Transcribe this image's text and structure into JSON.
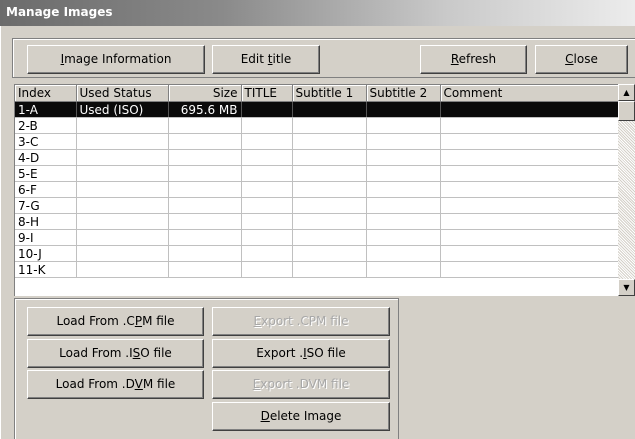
{
  "window": {
    "title": "Manage Images"
  },
  "toolbar": {
    "image_info": {
      "pre": "",
      "u": "I",
      "post": "mage Information"
    },
    "edit_title": {
      "pre": "Edit ",
      "u": "t",
      "post": "itle"
    },
    "refresh": {
      "pre": "",
      "u": "R",
      "post": "efresh"
    },
    "close": {
      "pre": "",
      "u": "C",
      "post": "lose"
    }
  },
  "table": {
    "columns": [
      "Index",
      "Used Status",
      "Size",
      "TITLE",
      "Subtitle 1",
      "Subtitle 2",
      "Comment"
    ],
    "rows": [
      [
        "1-A",
        "Used (ISO)",
        "695.6 MB",
        "",
        "",
        "",
        ""
      ],
      [
        "2-B",
        "",
        "",
        "",
        "",
        "",
        ""
      ],
      [
        "3-C",
        "",
        "",
        "",
        "",
        "",
        ""
      ],
      [
        "4-D",
        "",
        "",
        "",
        "",
        "",
        ""
      ],
      [
        "5-E",
        "",
        "",
        "",
        "",
        "",
        ""
      ],
      [
        "6-F",
        "",
        "",
        "",
        "",
        "",
        ""
      ],
      [
        "7-G",
        "",
        "",
        "",
        "",
        "",
        ""
      ],
      [
        "8-H",
        "",
        "",
        "",
        "",
        "",
        ""
      ],
      [
        "9-I",
        "",
        "",
        "",
        "",
        "",
        ""
      ],
      [
        "10-J",
        "",
        "",
        "",
        "",
        "",
        ""
      ],
      [
        "11-K",
        "",
        "",
        "",
        "",
        "",
        ""
      ]
    ],
    "selected_row": 0
  },
  "scrollbar": {
    "up_icon": "scroll-up-arrow-icon",
    "down_icon": "scroll-down-arrow-icon"
  },
  "actions": {
    "load_cpm": {
      "pre": "Load From .C",
      "u": "P",
      "post": "M file"
    },
    "export_cpm": {
      "pre": "",
      "u": "E",
      "post": "xport .CPM file"
    },
    "load_iso": {
      "pre": "Load From .I",
      "u": "S",
      "post": "O file"
    },
    "export_iso": {
      "pre": "Export .",
      "u": "I",
      "post": "SO file"
    },
    "load_dvm": {
      "pre": "Load From .D",
      "u": "V",
      "post": "M file"
    },
    "export_dvm": {
      "pre": "",
      "u": "E",
      "post": "xport .DVM file"
    },
    "delete": {
      "pre": "",
      "u": "D",
      "post": "elete Image"
    }
  },
  "colors": {
    "selection": "#0a0a0a",
    "face": "#d4d0c8",
    "disabled_text": "#a8a8a8"
  }
}
